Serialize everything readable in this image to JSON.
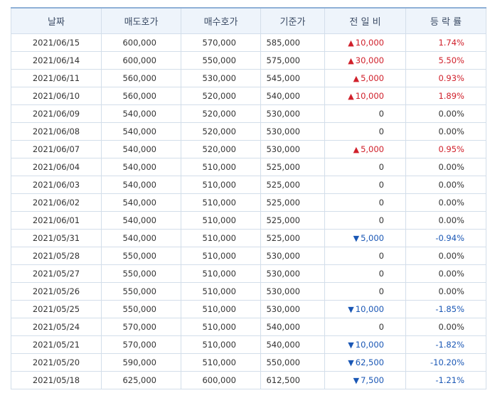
{
  "columns": [
    "날짜",
    "매도호가",
    "매수호가",
    "기준가",
    "전 일 비",
    "등 락 률"
  ],
  "rows": [
    {
      "date": "2021/06/15",
      "ask": "600,000",
      "bid": "570,000",
      "base": "585,000",
      "dir": "up",
      "change": "10,000",
      "rate": "1.74%"
    },
    {
      "date": "2021/06/14",
      "ask": "600,000",
      "bid": "550,000",
      "base": "575,000",
      "dir": "up",
      "change": "30,000",
      "rate": "5.50%"
    },
    {
      "date": "2021/06/11",
      "ask": "560,000",
      "bid": "530,000",
      "base": "545,000",
      "dir": "up",
      "change": "5,000",
      "rate": "0.93%"
    },
    {
      "date": "2021/06/10",
      "ask": "560,000",
      "bid": "520,000",
      "base": "540,000",
      "dir": "up",
      "change": "10,000",
      "rate": "1.89%"
    },
    {
      "date": "2021/06/09",
      "ask": "540,000",
      "bid": "520,000",
      "base": "530,000",
      "dir": "flat",
      "change": "0",
      "rate": "0.00%"
    },
    {
      "date": "2021/06/08",
      "ask": "540,000",
      "bid": "520,000",
      "base": "530,000",
      "dir": "flat",
      "change": "0",
      "rate": "0.00%"
    },
    {
      "date": "2021/06/07",
      "ask": "540,000",
      "bid": "520,000",
      "base": "530,000",
      "dir": "up",
      "change": "5,000",
      "rate": "0.95%"
    },
    {
      "date": "2021/06/04",
      "ask": "540,000",
      "bid": "510,000",
      "base": "525,000",
      "dir": "flat",
      "change": "0",
      "rate": "0.00%"
    },
    {
      "date": "2021/06/03",
      "ask": "540,000",
      "bid": "510,000",
      "base": "525,000",
      "dir": "flat",
      "change": "0",
      "rate": "0.00%"
    },
    {
      "date": "2021/06/02",
      "ask": "540,000",
      "bid": "510,000",
      "base": "525,000",
      "dir": "flat",
      "change": "0",
      "rate": "0.00%"
    },
    {
      "date": "2021/06/01",
      "ask": "540,000",
      "bid": "510,000",
      "base": "525,000",
      "dir": "flat",
      "change": "0",
      "rate": "0.00%"
    },
    {
      "date": "2021/05/31",
      "ask": "540,000",
      "bid": "510,000",
      "base": "525,000",
      "dir": "down",
      "change": "5,000",
      "rate": "-0.94%"
    },
    {
      "date": "2021/05/28",
      "ask": "550,000",
      "bid": "510,000",
      "base": "530,000",
      "dir": "flat",
      "change": "0",
      "rate": "0.00%"
    },
    {
      "date": "2021/05/27",
      "ask": "550,000",
      "bid": "510,000",
      "base": "530,000",
      "dir": "flat",
      "change": "0",
      "rate": "0.00%"
    },
    {
      "date": "2021/05/26",
      "ask": "550,000",
      "bid": "510,000",
      "base": "530,000",
      "dir": "flat",
      "change": "0",
      "rate": "0.00%"
    },
    {
      "date": "2021/05/25",
      "ask": "550,000",
      "bid": "510,000",
      "base": "530,000",
      "dir": "down",
      "change": "10,000",
      "rate": "-1.85%"
    },
    {
      "date": "2021/05/24",
      "ask": "570,000",
      "bid": "510,000",
      "base": "540,000",
      "dir": "flat",
      "change": "0",
      "rate": "0.00%"
    },
    {
      "date": "2021/05/21",
      "ask": "570,000",
      "bid": "510,000",
      "base": "540,000",
      "dir": "down",
      "change": "10,000",
      "rate": "-1.82%"
    },
    {
      "date": "2021/05/20",
      "ask": "590,000",
      "bid": "510,000",
      "base": "550,000",
      "dir": "down",
      "change": "62,500",
      "rate": "-10.20%"
    },
    {
      "date": "2021/05/18",
      "ask": "625,000",
      "bid": "600,000",
      "base": "612,500",
      "dir": "down",
      "change": "7,500",
      "rate": "-1.21%"
    }
  ],
  "symbols": {
    "up": "▲",
    "down": "▼"
  },
  "colors": {
    "up": "#d0202b",
    "down": "#1a57b5",
    "header_bg": "#eef4fb",
    "border": "#d3deea"
  }
}
